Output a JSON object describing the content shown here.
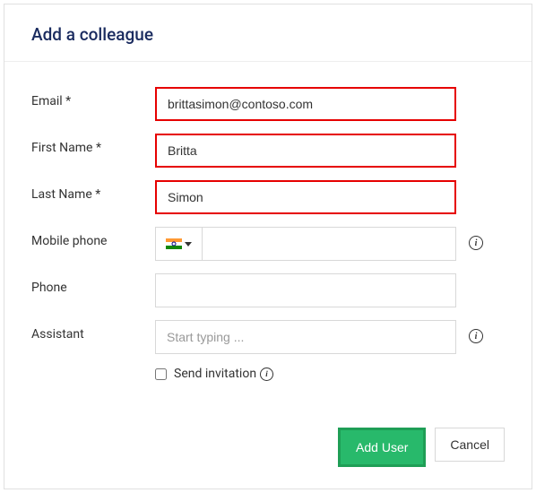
{
  "title": "Add a colleague",
  "fields": {
    "email": {
      "label": "Email *",
      "value": "brittasimon@contoso.com"
    },
    "firstName": {
      "label": "First Name *",
      "value": "Britta"
    },
    "lastName": {
      "label": "Last Name *",
      "value": "Simon"
    },
    "mobilePhone": {
      "label": "Mobile phone",
      "value": "",
      "countryName": "India"
    },
    "phone": {
      "label": "Phone",
      "value": ""
    },
    "assistant": {
      "label": "Assistant",
      "placeholder": "Start typing ...",
      "value": ""
    }
  },
  "sendInvitation": {
    "label": "Send invitation",
    "checked": false
  },
  "buttons": {
    "addUser": "Add User",
    "cancel": "Cancel"
  }
}
